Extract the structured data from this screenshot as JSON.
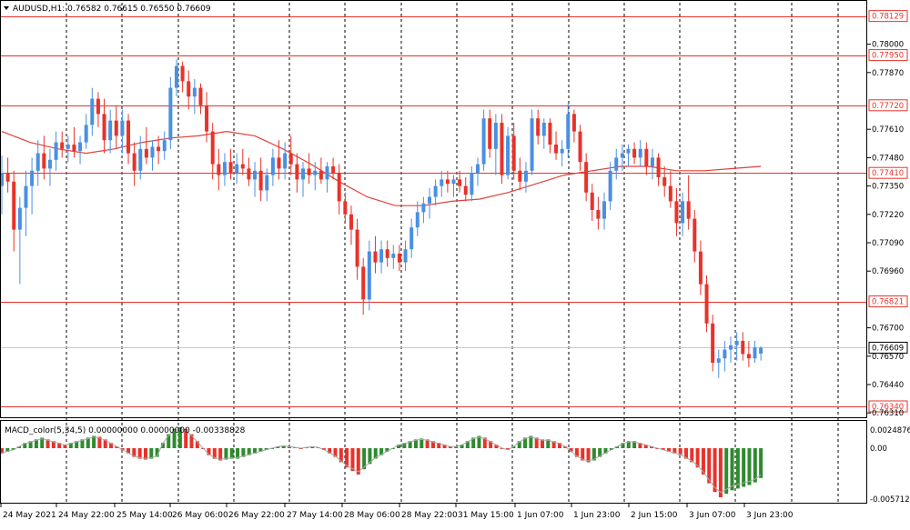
{
  "header": {
    "menu_icon": "triangle-down-icon",
    "symbol_info": "AUDUSD,H1: 0.76582 0.76615 0.76550 0.76609"
  },
  "colors": {
    "bull": "#4a90e2",
    "bear": "#e8322a",
    "level_line": "#e8322a",
    "ma_line": "#e0413a",
    "grid": "#000000",
    "macd_up": "#2e8b2e",
    "macd_down": "#e8322a",
    "signal_line": "#a8a8a8",
    "current_price_line": "#c8c8c8",
    "label_fill": "#ffffff",
    "current_label_fill": "#ffffff"
  },
  "price_axis": {
    "ticks": [
      "0.78000",
      "0.77870",
      "0.77610",
      "0.77480",
      "0.77350",
      "0.77220",
      "0.77090",
      "0.76960",
      "0.76700",
      "0.76570",
      "0.76440",
      "0.76310"
    ]
  },
  "level_labels": [
    {
      "text": "0.78129",
      "price": 0.78129
    },
    {
      "text": "0.77950",
      "price": 0.7795
    },
    {
      "text": "0.77720",
      "price": 0.7772
    },
    {
      "text": "0.77410",
      "price": 0.7741
    },
    {
      "text": "0.76821",
      "price": 0.76821
    },
    {
      "text": "0.76340",
      "price": 0.7634
    }
  ],
  "current_price": {
    "text": "0.76609",
    "price": 0.76609
  },
  "macd": {
    "title": "MACD_color(5,34,5) 0.00000000 0.00000000 -0.00338828",
    "ticks": [
      "0.0024876",
      "0.00",
      "-0.0057120"
    ]
  },
  "time_axis": {
    "labels": [
      "24 May 2021",
      "24 May 22:00",
      "25 May 14:00",
      "26 May 06:00",
      "26 May 22:00",
      "27 May 14:00",
      "28 May 06:00",
      "28 May 22:00",
      "31 May 15:00",
      "1 Jun 07:00",
      "1 Jun 23:00",
      "2 Jun 15:00",
      "3 Jun 07:00",
      "3 Jun 23:00"
    ]
  },
  "chart_data": {
    "type": "candlestick",
    "symbol": "AUDUSD",
    "timeframe": "H1",
    "y_range": [
      0.7629,
      0.7819
    ],
    "candles": [
      {
        "o": 0.7735,
        "h": 0.7749,
        "l": 0.7722,
        "c": 0.7741
      },
      {
        "o": 0.7741,
        "h": 0.7748,
        "l": 0.7732,
        "c": 0.7737
      },
      {
        "o": 0.7737,
        "h": 0.7742,
        "l": 0.7705,
        "c": 0.7715
      },
      {
        "o": 0.7715,
        "h": 0.773,
        "l": 0.769,
        "c": 0.7725
      },
      {
        "o": 0.7725,
        "h": 0.7742,
        "l": 0.7712,
        "c": 0.7735
      },
      {
        "o": 0.7735,
        "h": 0.7748,
        "l": 0.7722,
        "c": 0.7742
      },
      {
        "o": 0.7742,
        "h": 0.7756,
        "l": 0.7735,
        "c": 0.775
      },
      {
        "o": 0.775,
        "h": 0.7758,
        "l": 0.7738,
        "c": 0.7743
      },
      {
        "o": 0.7743,
        "h": 0.7752,
        "l": 0.7735,
        "c": 0.7747
      },
      {
        "o": 0.7747,
        "h": 0.776,
        "l": 0.7742,
        "c": 0.7755
      },
      {
        "o": 0.7755,
        "h": 0.776,
        "l": 0.7748,
        "c": 0.7752
      },
      {
        "o": 0.7752,
        "h": 0.7758,
        "l": 0.7746,
        "c": 0.7754
      },
      {
        "o": 0.7754,
        "h": 0.7762,
        "l": 0.7748,
        "c": 0.7751
      },
      {
        "o": 0.7751,
        "h": 0.7758,
        "l": 0.7745,
        "c": 0.7755
      },
      {
        "o": 0.7755,
        "h": 0.7768,
        "l": 0.7752,
        "c": 0.7763
      },
      {
        "o": 0.7763,
        "h": 0.778,
        "l": 0.7758,
        "c": 0.7775
      },
      {
        "o": 0.7775,
        "h": 0.7778,
        "l": 0.7762,
        "c": 0.7768
      },
      {
        "o": 0.7768,
        "h": 0.7775,
        "l": 0.775,
        "c": 0.7756
      },
      {
        "o": 0.7756,
        "h": 0.777,
        "l": 0.775,
        "c": 0.7765
      },
      {
        "o": 0.7765,
        "h": 0.7772,
        "l": 0.7752,
        "c": 0.7758
      },
      {
        "o": 0.7758,
        "h": 0.777,
        "l": 0.775,
        "c": 0.7765
      },
      {
        "o": 0.7765,
        "h": 0.7768,
        "l": 0.7745,
        "c": 0.775
      },
      {
        "o": 0.775,
        "h": 0.7755,
        "l": 0.7735,
        "c": 0.7742
      },
      {
        "o": 0.7742,
        "h": 0.7758,
        "l": 0.7738,
        "c": 0.7752
      },
      {
        "o": 0.7752,
        "h": 0.7762,
        "l": 0.7745,
        "c": 0.7748
      },
      {
        "o": 0.7748,
        "h": 0.7756,
        "l": 0.7742,
        "c": 0.7753
      },
      {
        "o": 0.7753,
        "h": 0.7758,
        "l": 0.7745,
        "c": 0.7751
      },
      {
        "o": 0.7751,
        "h": 0.776,
        "l": 0.7747,
        "c": 0.7756
      },
      {
        "o": 0.7756,
        "h": 0.7785,
        "l": 0.7752,
        "c": 0.778
      },
      {
        "o": 0.778,
        "h": 0.7793,
        "l": 0.7776,
        "c": 0.779
      },
      {
        "o": 0.779,
        "h": 0.7792,
        "l": 0.7778,
        "c": 0.7783
      },
      {
        "o": 0.7783,
        "h": 0.7788,
        "l": 0.777,
        "c": 0.7776
      },
      {
        "o": 0.7776,
        "h": 0.7784,
        "l": 0.7768,
        "c": 0.778
      },
      {
        "o": 0.778,
        "h": 0.7782,
        "l": 0.7768,
        "c": 0.7772
      },
      {
        "o": 0.7772,
        "h": 0.7778,
        "l": 0.7755,
        "c": 0.776
      },
      {
        "o": 0.776,
        "h": 0.7764,
        "l": 0.7738,
        "c": 0.7745
      },
      {
        "o": 0.7745,
        "h": 0.7752,
        "l": 0.7733,
        "c": 0.774
      },
      {
        "o": 0.774,
        "h": 0.775,
        "l": 0.7735,
        "c": 0.7746
      },
      {
        "o": 0.7746,
        "h": 0.7752,
        "l": 0.7738,
        "c": 0.7741
      },
      {
        "o": 0.7741,
        "h": 0.775,
        "l": 0.7736,
        "c": 0.7745
      },
      {
        "o": 0.7745,
        "h": 0.7752,
        "l": 0.774,
        "c": 0.7743
      },
      {
        "o": 0.7743,
        "h": 0.7748,
        "l": 0.7735,
        "c": 0.7738
      },
      {
        "o": 0.7738,
        "h": 0.7746,
        "l": 0.773,
        "c": 0.7742
      },
      {
        "o": 0.7742,
        "h": 0.7748,
        "l": 0.7728,
        "c": 0.7733
      },
      {
        "o": 0.7733,
        "h": 0.7743,
        "l": 0.7728,
        "c": 0.774
      },
      {
        "o": 0.774,
        "h": 0.7752,
        "l": 0.7735,
        "c": 0.7748
      },
      {
        "o": 0.7748,
        "h": 0.7756,
        "l": 0.7738,
        "c": 0.7743
      },
      {
        "o": 0.7743,
        "h": 0.7755,
        "l": 0.7738,
        "c": 0.775
      },
      {
        "o": 0.775,
        "h": 0.7758,
        "l": 0.774,
        "c": 0.7745
      },
      {
        "o": 0.7745,
        "h": 0.775,
        "l": 0.7732,
        "c": 0.7738
      },
      {
        "o": 0.7738,
        "h": 0.7746,
        "l": 0.773,
        "c": 0.7743
      },
      {
        "o": 0.7743,
        "h": 0.775,
        "l": 0.7736,
        "c": 0.774
      },
      {
        "o": 0.774,
        "h": 0.7746,
        "l": 0.7733,
        "c": 0.7742
      },
      {
        "o": 0.7742,
        "h": 0.7748,
        "l": 0.7736,
        "c": 0.7738
      },
      {
        "o": 0.7738,
        "h": 0.7746,
        "l": 0.7732,
        "c": 0.7744
      },
      {
        "o": 0.7744,
        "h": 0.7748,
        "l": 0.7738,
        "c": 0.7741
      },
      {
        "o": 0.7741,
        "h": 0.7745,
        "l": 0.7722,
        "c": 0.7728
      },
      {
        "o": 0.7728,
        "h": 0.7732,
        "l": 0.7718,
        "c": 0.7722
      },
      {
        "o": 0.7722,
        "h": 0.7726,
        "l": 0.7708,
        "c": 0.7715
      },
      {
        "o": 0.7715,
        "h": 0.772,
        "l": 0.7692,
        "c": 0.7698
      },
      {
        "o": 0.7698,
        "h": 0.7702,
        "l": 0.7676,
        "c": 0.7683
      },
      {
        "o": 0.7683,
        "h": 0.771,
        "l": 0.7678,
        "c": 0.7705
      },
      {
        "o": 0.7705,
        "h": 0.7712,
        "l": 0.7695,
        "c": 0.77
      },
      {
        "o": 0.77,
        "h": 0.771,
        "l": 0.7695,
        "c": 0.7706
      },
      {
        "o": 0.7706,
        "h": 0.771,
        "l": 0.7698,
        "c": 0.7702
      },
      {
        "o": 0.7702,
        "h": 0.7708,
        "l": 0.7697,
        "c": 0.7704
      },
      {
        "o": 0.7704,
        "h": 0.7708,
        "l": 0.7696,
        "c": 0.77
      },
      {
        "o": 0.77,
        "h": 0.771,
        "l": 0.7696,
        "c": 0.7706
      },
      {
        "o": 0.7706,
        "h": 0.772,
        "l": 0.7702,
        "c": 0.7716
      },
      {
        "o": 0.7716,
        "h": 0.7728,
        "l": 0.7712,
        "c": 0.7723
      },
      {
        "o": 0.7723,
        "h": 0.773,
        "l": 0.7718,
        "c": 0.7727
      },
      {
        "o": 0.7727,
        "h": 0.7734,
        "l": 0.772,
        "c": 0.773
      },
      {
        "o": 0.773,
        "h": 0.7738,
        "l": 0.7726,
        "c": 0.7735
      },
      {
        "o": 0.7735,
        "h": 0.7742,
        "l": 0.773,
        "c": 0.7738
      },
      {
        "o": 0.7738,
        "h": 0.7742,
        "l": 0.7732,
        "c": 0.7736
      },
      {
        "o": 0.7736,
        "h": 0.774,
        "l": 0.773,
        "c": 0.7738
      },
      {
        "o": 0.7738,
        "h": 0.7742,
        "l": 0.7732,
        "c": 0.7735
      },
      {
        "o": 0.7735,
        "h": 0.7739,
        "l": 0.7728,
        "c": 0.7731
      },
      {
        "o": 0.7731,
        "h": 0.7744,
        "l": 0.7728,
        "c": 0.7741
      },
      {
        "o": 0.7741,
        "h": 0.7748,
        "l": 0.7735,
        "c": 0.7745
      },
      {
        "o": 0.7745,
        "h": 0.777,
        "l": 0.7742,
        "c": 0.7766
      },
      {
        "o": 0.7766,
        "h": 0.777,
        "l": 0.7748,
        "c": 0.7752
      },
      {
        "o": 0.7752,
        "h": 0.7768,
        "l": 0.774,
        "c": 0.7764
      },
      {
        "o": 0.7764,
        "h": 0.7768,
        "l": 0.7736,
        "c": 0.774
      },
      {
        "o": 0.774,
        "h": 0.7762,
        "l": 0.7738,
        "c": 0.7758
      },
      {
        "o": 0.7758,
        "h": 0.7764,
        "l": 0.7738,
        "c": 0.7742
      },
      {
        "o": 0.7742,
        "h": 0.7748,
        "l": 0.7733,
        "c": 0.7737
      },
      {
        "o": 0.7737,
        "h": 0.7746,
        "l": 0.7732,
        "c": 0.7742
      },
      {
        "o": 0.7742,
        "h": 0.777,
        "l": 0.774,
        "c": 0.7766
      },
      {
        "o": 0.7766,
        "h": 0.777,
        "l": 0.7754,
        "c": 0.7758
      },
      {
        "o": 0.7758,
        "h": 0.7766,
        "l": 0.7752,
        "c": 0.7764
      },
      {
        "o": 0.7764,
        "h": 0.7766,
        "l": 0.775,
        "c": 0.7754
      },
      {
        "o": 0.7754,
        "h": 0.776,
        "l": 0.7747,
        "c": 0.775
      },
      {
        "o": 0.775,
        "h": 0.7756,
        "l": 0.7744,
        "c": 0.7752
      },
      {
        "o": 0.7752,
        "h": 0.7773,
        "l": 0.7748,
        "c": 0.7768
      },
      {
        "o": 0.7768,
        "h": 0.777,
        "l": 0.7755,
        "c": 0.776
      },
      {
        "o": 0.776,
        "h": 0.7763,
        "l": 0.7742,
        "c": 0.7746
      },
      {
        "o": 0.7746,
        "h": 0.775,
        "l": 0.7728,
        "c": 0.7732
      },
      {
        "o": 0.7732,
        "h": 0.7736,
        "l": 0.7719,
        "c": 0.7724
      },
      {
        "o": 0.7724,
        "h": 0.773,
        "l": 0.7715,
        "c": 0.772
      },
      {
        "o": 0.772,
        "h": 0.7732,
        "l": 0.7715,
        "c": 0.7728
      },
      {
        "o": 0.7728,
        "h": 0.7746,
        "l": 0.7724,
        "c": 0.7742
      },
      {
        "o": 0.7742,
        "h": 0.7752,
        "l": 0.7738,
        "c": 0.7748
      },
      {
        "o": 0.7748,
        "h": 0.7754,
        "l": 0.7742,
        "c": 0.775
      },
      {
        "o": 0.775,
        "h": 0.7754,
        "l": 0.7744,
        "c": 0.7752
      },
      {
        "o": 0.7752,
        "h": 0.7755,
        "l": 0.7745,
        "c": 0.7748
      },
      {
        "o": 0.7748,
        "h": 0.7756,
        "l": 0.7744,
        "c": 0.7752
      },
      {
        "o": 0.7752,
        "h": 0.7755,
        "l": 0.774,
        "c": 0.7744
      },
      {
        "o": 0.7744,
        "h": 0.7752,
        "l": 0.7738,
        "c": 0.7748
      },
      {
        "o": 0.7748,
        "h": 0.775,
        "l": 0.7735,
        "c": 0.7739
      },
      {
        "o": 0.7739,
        "h": 0.7744,
        "l": 0.773,
        "c": 0.7735
      },
      {
        "o": 0.7735,
        "h": 0.7742,
        "l": 0.7725,
        "c": 0.7728
      },
      {
        "o": 0.7728,
        "h": 0.7734,
        "l": 0.7712,
        "c": 0.7718
      },
      {
        "o": 0.7718,
        "h": 0.7732,
        "l": 0.7712,
        "c": 0.7728
      },
      {
        "o": 0.7728,
        "h": 0.774,
        "l": 0.7715,
        "c": 0.772
      },
      {
        "o": 0.772,
        "h": 0.7724,
        "l": 0.77,
        "c": 0.7705
      },
      {
        "o": 0.7705,
        "h": 0.771,
        "l": 0.7685,
        "c": 0.769
      },
      {
        "o": 0.769,
        "h": 0.7694,
        "l": 0.7668,
        "c": 0.7672
      },
      {
        "o": 0.7672,
        "h": 0.7676,
        "l": 0.765,
        "c": 0.7654
      },
      {
        "o": 0.7654,
        "h": 0.766,
        "l": 0.7647,
        "c": 0.7656
      },
      {
        "o": 0.7656,
        "h": 0.7664,
        "l": 0.765,
        "c": 0.766
      },
      {
        "o": 0.766,
        "h": 0.7666,
        "l": 0.7654,
        "c": 0.7662
      },
      {
        "o": 0.7662,
        "h": 0.7668,
        "l": 0.7655,
        "c": 0.7664
      },
      {
        "o": 0.7664,
        "h": 0.7668,
        "l": 0.7655,
        "c": 0.7658
      },
      {
        "o": 0.7658,
        "h": 0.7664,
        "l": 0.7652,
        "c": 0.7656
      },
      {
        "o": 0.7656,
        "h": 0.7664,
        "l": 0.7654,
        "c": 0.7661
      },
      {
        "o": 0.76582,
        "h": 0.76615,
        "l": 0.7655,
        "c": 0.76609
      }
    ],
    "moving_average": [
      0.776,
      0.7755,
      0.7752,
      0.775,
      0.7752,
      0.7755,
      0.7757,
      0.7758,
      0.776,
      0.7758,
      0.7752,
      0.7745,
      0.7737,
      0.773,
      0.7726,
      0.7726,
      0.7728,
      0.7729,
      0.7732,
      0.7736,
      0.774,
      0.7742,
      0.7744,
      0.7744,
      0.7742,
      0.7742,
      0.7743,
      0.7744
    ],
    "macd_histogram": [
      -0.0006,
      -0.0004,
      -0.0002,
      0.0002,
      0.0006,
      0.0008,
      0.001,
      0.0012,
      0.001,
      0.0008,
      0.0006,
      0.0004,
      0.0006,
      0.0008,
      0.001,
      0.0012,
      0.0014,
      0.0013,
      0.001,
      0.0006,
      0.0002,
      -0.0002,
      -0.0006,
      -0.001,
      -0.0012,
      -0.0013,
      -0.0012,
      -0.001,
      0.0006,
      0.0016,
      0.0022,
      0.0024,
      0.0022,
      0.0016,
      0.0008,
      0.0,
      -0.0008,
      -0.0012,
      -0.0014,
      -0.0013,
      -0.0012,
      -0.0012,
      -0.001,
      -0.0008,
      -0.0006,
      -0.0004,
      -0.0002,
      0.0,
      0.0002,
      0.0003,
      0.0002,
      0.0001,
      0.0,
      0.0001,
      0.0002,
      0.0001,
      -0.0002,
      -0.0006,
      -0.001,
      -0.0016,
      -0.0022,
      -0.0026,
      -0.003,
      -0.0024,
      -0.0018,
      -0.0012,
      -0.0008,
      -0.0004,
      0.0,
      0.0004,
      0.0006,
      0.0008,
      0.001,
      0.0011,
      0.001,
      0.0008,
      0.0006,
      0.0004,
      0.0002,
      0.0002,
      0.0004,
      0.0008,
      0.0012,
      0.0014,
      0.0012,
      0.0008,
      0.0004,
      0.0,
      -0.0002,
      0.0002,
      0.0008,
      0.0012,
      0.0014,
      0.0012,
      0.001,
      0.001,
      0.0008,
      0.0006,
      0.0002,
      -0.0004,
      -0.001,
      -0.0014,
      -0.0016,
      -0.0014,
      -0.001,
      -0.0006,
      -0.0002,
      0.0002,
      0.0006,
      0.0008,
      0.0008,
      0.0006,
      0.0004,
      0.0002,
      0.0,
      -0.0002,
      -0.0004,
      -0.0006,
      -0.0008,
      -0.0012,
      -0.0016,
      -0.0022,
      -0.003,
      -0.004,
      -0.005,
      -0.0056,
      -0.0052,
      -0.0048,
      -0.0046,
      -0.0044,
      -0.0042,
      -0.0039,
      -0.0034
    ]
  }
}
